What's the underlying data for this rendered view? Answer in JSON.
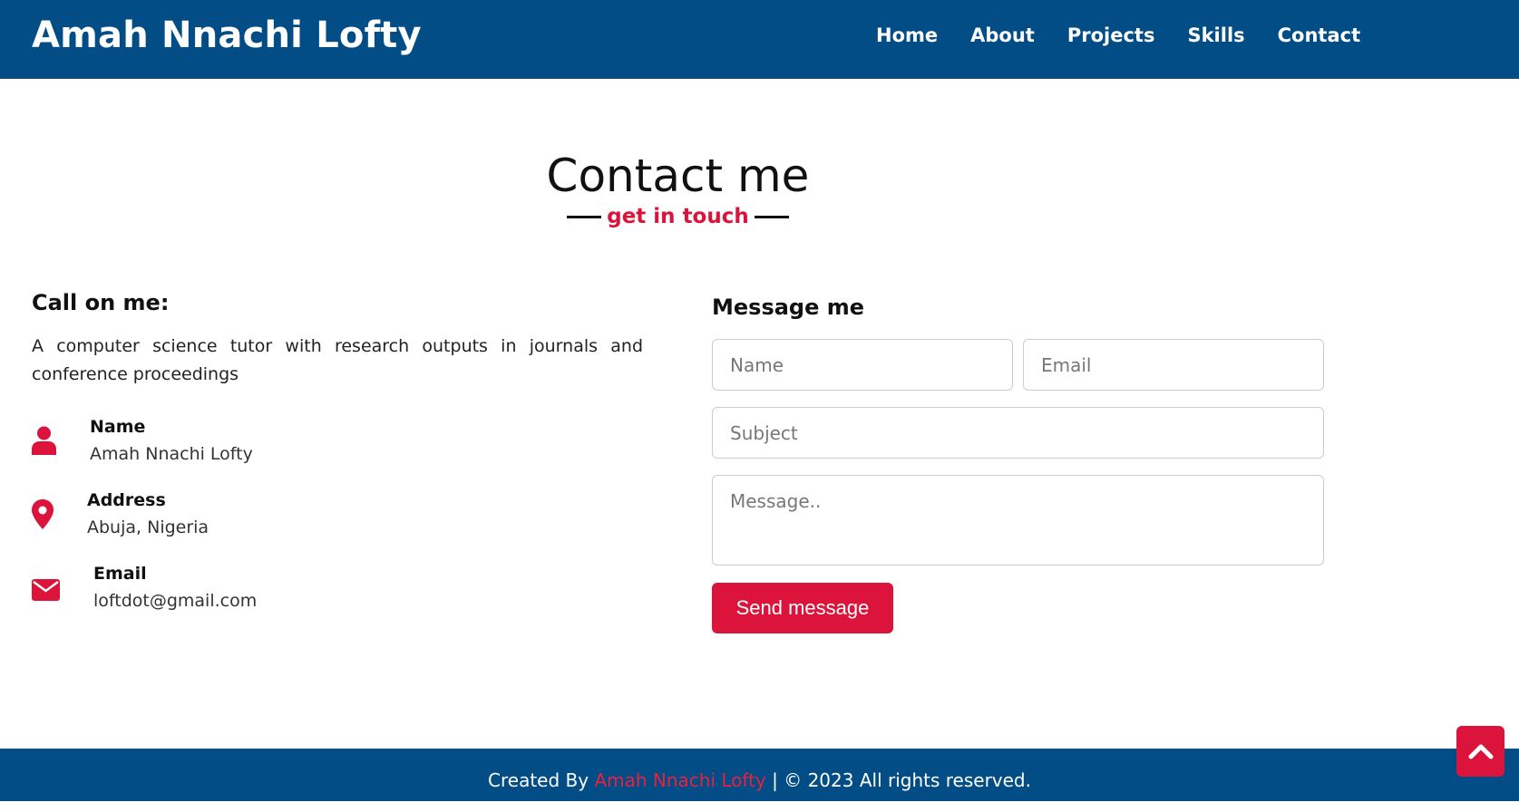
{
  "header": {
    "brand": "Amah Nnachi Lofty",
    "nav": [
      "Home",
      "About",
      "Projects",
      "Skills",
      "Contact"
    ]
  },
  "section": {
    "title": "Contact me",
    "subtitle": "get in touch"
  },
  "contact_info": {
    "heading": "Call on me:",
    "bio": "A computer science tutor with research outputs in journals and conference proceedings",
    "items": [
      {
        "icon": "user-icon",
        "label": "Name",
        "value": "Amah Nnachi Lofty"
      },
      {
        "icon": "map-marker-icon",
        "label": "Address",
        "value": "Abuja, Nigeria"
      },
      {
        "icon": "envelope-icon",
        "label": "Email",
        "value": "loftdot@gmail.com"
      }
    ]
  },
  "form": {
    "heading": "Message me",
    "name_placeholder": "Name",
    "email_placeholder": "Email",
    "subject_placeholder": "Subject",
    "message_placeholder": "Message..",
    "send_label": "Send message"
  },
  "footer": {
    "prefix": "Created By ",
    "author": "Amah Nnachi Lofty",
    "suffix": " | © 2023 All rights reserved."
  },
  "colors": {
    "primary": "#034d87",
    "accent": "#dc143c"
  }
}
